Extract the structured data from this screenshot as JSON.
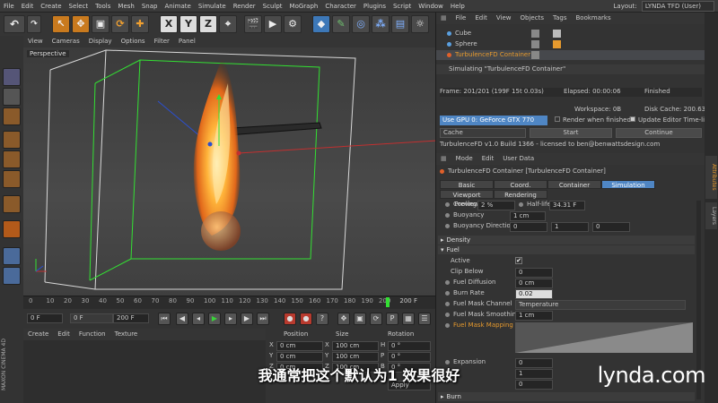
{
  "menubar": {
    "items": [
      "File",
      "Edit",
      "Create",
      "Select",
      "Tools",
      "Mesh",
      "Snap",
      "Animate",
      "Simulate",
      "Render",
      "Sculpt",
      "MoGraph",
      "Character",
      "Plugins",
      "Script",
      "Window",
      "Help"
    ],
    "layout_label": "Layout:",
    "layout_value": "LYNDA TFD (User)"
  },
  "toolbar": {
    "xyz": [
      "X",
      "Y",
      "Z"
    ]
  },
  "viewport": {
    "menu": [
      "View",
      "Cameras",
      "Display",
      "Options",
      "Filter",
      "Panel"
    ],
    "label": "Perspective"
  },
  "timeline": {
    "ticks": [
      "0",
      "10",
      "20",
      "30",
      "40",
      "50",
      "60",
      "70",
      "80",
      "90",
      "100",
      "110",
      "120",
      "130",
      "140",
      "150",
      "160",
      "170",
      "180",
      "190",
      "200"
    ],
    "end_label": "200 F"
  },
  "transport": {
    "start": "0 F",
    "current": "0 F",
    "end": "200 F",
    "max": "200 F"
  },
  "material": {
    "menu": [
      "Create",
      "Edit",
      "Function",
      "Texture"
    ]
  },
  "coords": {
    "headers": [
      "Position",
      "Size",
      "Rotation"
    ],
    "rows": [
      {
        "axis": "X",
        "pos": "0 cm",
        "size": "100 cm",
        "rlabel": "H",
        "rot": "0 °"
      },
      {
        "axis": "Y",
        "pos": "0 cm",
        "size": "100 cm",
        "rlabel": "P",
        "rot": "0 °"
      },
      {
        "axis": "Z",
        "pos": "0 cm",
        "size": "100 cm",
        "rlabel": "B",
        "rot": "0 °"
      }
    ],
    "apply": "Apply"
  },
  "objmgr": {
    "menu": [
      "File",
      "Edit",
      "View",
      "Objects",
      "Tags",
      "Bookmarks"
    ],
    "objects": [
      "Cube",
      "Sphere",
      "TurbulenceFD Container"
    ]
  },
  "sim": {
    "title": "Simulating \"TurbulenceFD Container\"",
    "frame": "Frame: 201/201 (199F 15t 0.03s)",
    "elapsed": "Elapsed: 00:00:06",
    "status": "Finished",
    "workspace": "Workspace: 0B",
    "diskcache": "Disk Cache: 200.63MB",
    "gpu": "Use GPU 0: GeForce GTX 770",
    "render_when": "Render when finished",
    "update_editor": "Update Editor Time-line",
    "cache": "Cache",
    "start": "Start",
    "continue": "Continue",
    "license": "TurbulenceFD v1.0 Build 1366 - licensed to ben@benwattsdesign.com"
  },
  "attr": {
    "menu": [
      "Mode",
      "Edit",
      "User Data"
    ],
    "title": "TurbulenceFD Container [TurbulenceFD Container]",
    "tabs": [
      "Basic",
      "Coord.",
      "Container",
      "Simulation",
      "Viewport Preview",
      "Rendering"
    ],
    "cooling_label": "Cooling",
    "cooling": "2 %",
    "halflife_label": "Half-life",
    "halflife": "34.31 F",
    "buoyancy_label": "Buoyancy",
    "buoyancy": "1 cm",
    "buoydir_label": "Buoyancy Direction",
    "buoydir": [
      "0",
      "1",
      "0"
    ],
    "density": "Density",
    "fuel": "Fuel",
    "active": "Active",
    "clip": "Clip Below",
    "clip_val": "0",
    "fueldiff": "Fuel Diffusion",
    "fueldiff_val": "0 cm",
    "burnrate": "Burn Rate",
    "burnrate_val": "0.02",
    "maskchan": "Fuel Mask Channel",
    "maskchan_val": "Temperature",
    "masksmooth": "Fuel Mask Smoothing",
    "masksmooth_val": "1 cm",
    "maskmap": "Fuel Mask Mapping",
    "expansion": "Expansion",
    "expansion_val": "0",
    "r1": "1",
    "r2": "0",
    "burn": "Burn"
  },
  "tabs_right": [
    "Attributes",
    "Layers"
  ],
  "subtitle": "我通常把这个默认为1  效果很好",
  "brand": "lynda.com",
  "maxon": "MAXON CINEMA 4D",
  "colors": {
    "accent": "#e69a2e",
    "tab_active": "#4f86c4",
    "fire": "#f08a1c"
  }
}
